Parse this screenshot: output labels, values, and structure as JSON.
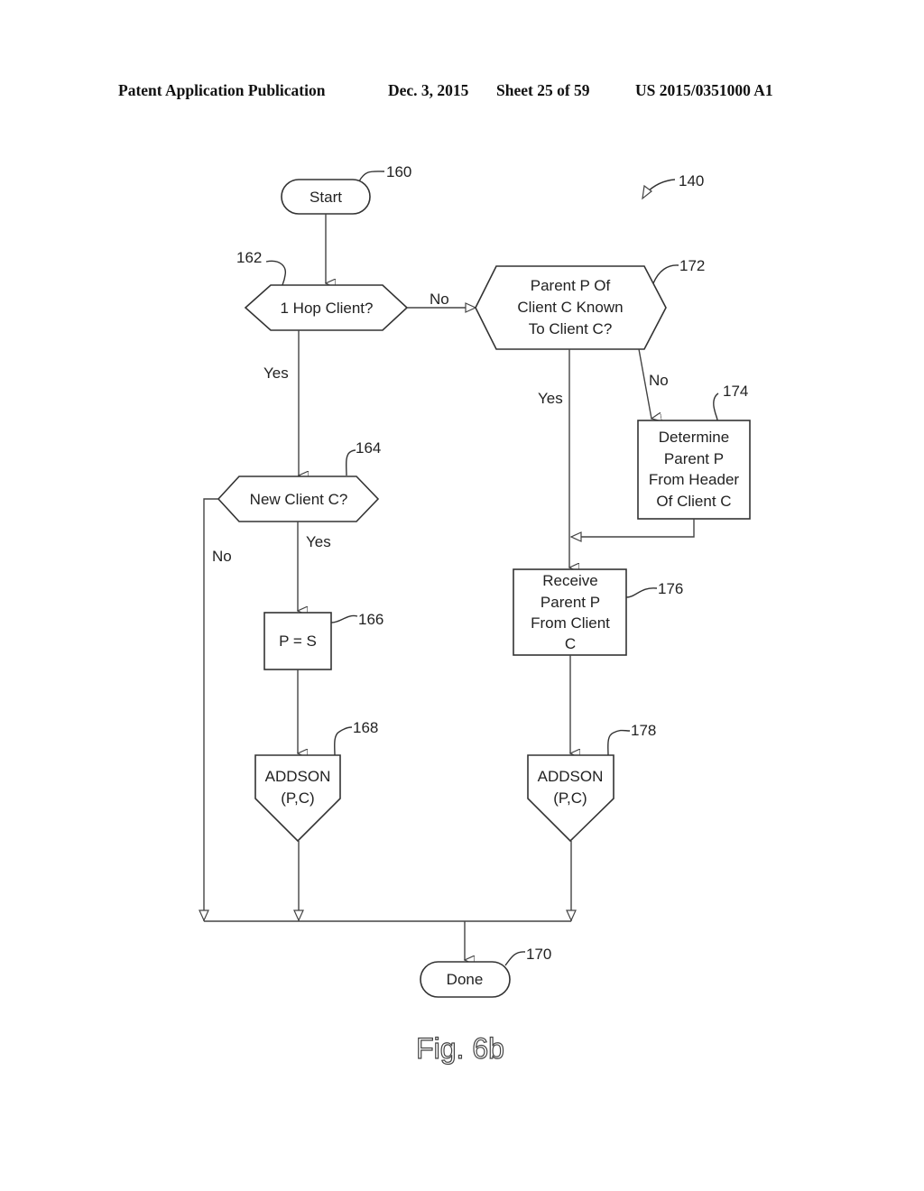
{
  "header": {
    "publication": "Patent Application Publication",
    "date": "Dec. 3, 2015",
    "sheet": "Sheet 25 of 59",
    "number": "US 2015/0351000 A1"
  },
  "figure": {
    "caption": "Fig. 6b",
    "ref": "140"
  },
  "nodes": {
    "start": {
      "ref": "160",
      "lines": [
        "Start"
      ]
    },
    "hop": {
      "ref": "162",
      "lines": [
        "1 Hop Client?"
      ]
    },
    "new_client": {
      "ref": "164",
      "lines": [
        "New Client C?"
      ]
    },
    "p_eq_s": {
      "ref": "166",
      "lines": [
        "P = S"
      ]
    },
    "addson_left": {
      "ref": "168",
      "lines": [
        "ADDSON",
        "(P,C)"
      ]
    },
    "done": {
      "ref": "170",
      "lines": [
        "Done"
      ]
    },
    "parent_known": {
      "ref": "172",
      "lines": [
        "Parent P Of",
        "Client C Known",
        "To Client C?"
      ]
    },
    "determine": {
      "ref": "174",
      "lines": [
        "Determine",
        "Parent P",
        "From Header",
        "Of Client C"
      ]
    },
    "receive": {
      "ref": "176",
      "lines": [
        "Receive",
        "Parent P",
        "From Client",
        "C"
      ]
    },
    "addson_right": {
      "ref": "178",
      "lines": [
        "ADDSON",
        "(P,C)"
      ]
    }
  },
  "edges": {
    "hop_no": "No",
    "hop_yes": "Yes",
    "new_client_yes": "Yes",
    "new_client_no": "No",
    "parent_known_yes": "Yes",
    "parent_known_no": "No"
  }
}
